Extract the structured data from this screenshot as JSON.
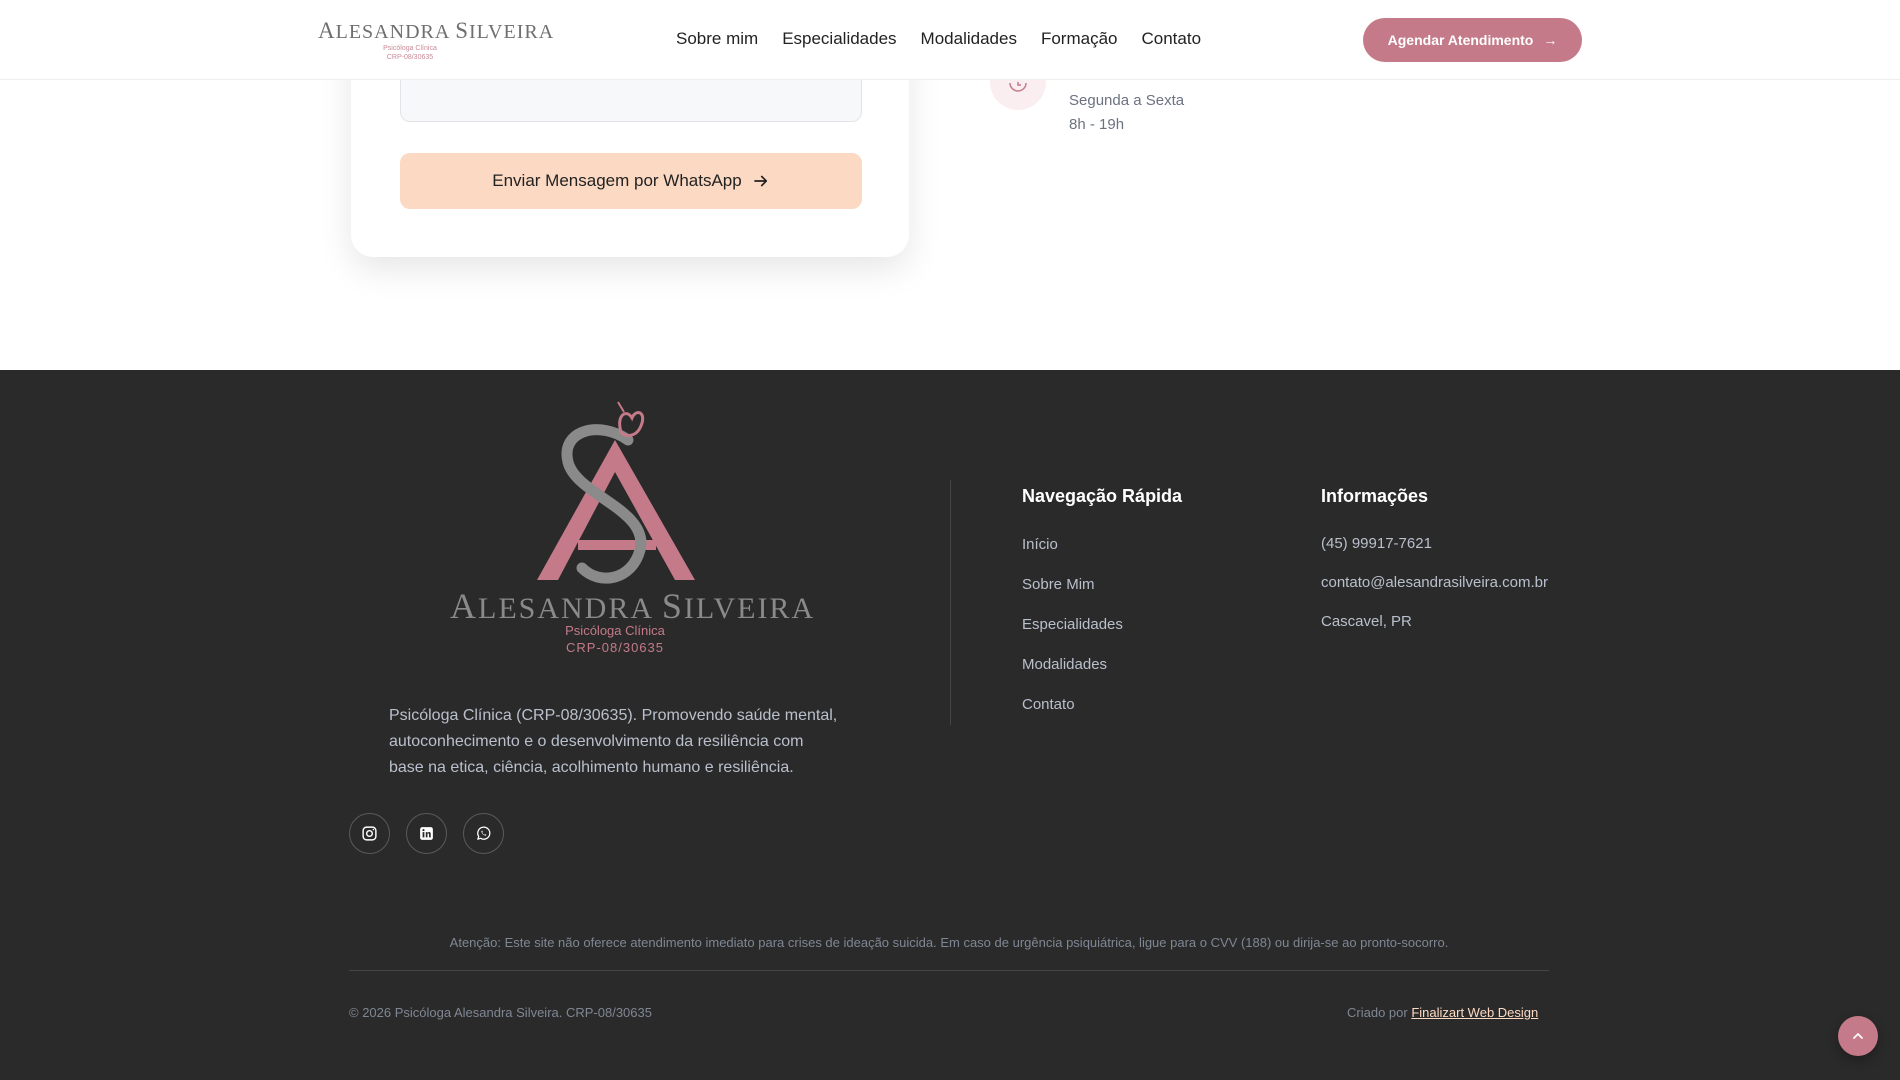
{
  "header": {
    "logo": {
      "name_first_cap": "A",
      "name_first_rest": "LESANDRA",
      "name_last_cap": "S",
      "name_last_rest": "ILVEIRA",
      "subtitle1": "Psicóloga Clínica",
      "subtitle2": "CRP-08/30635"
    },
    "nav": [
      "Sobre mim",
      "Especialidades",
      "Modalidades",
      "Formação",
      "Contato"
    ],
    "cta_label": "Agendar Atendimento"
  },
  "form": {
    "send_button_label": "Enviar Mensagem por WhatsApp"
  },
  "hours": {
    "days": "Segunda a Sexta",
    "time": "8h - 19h"
  },
  "footer": {
    "logo": {
      "name_first_cap": "A",
      "name_first_rest": "LESANDRA",
      "name_last_cap": "S",
      "name_last_rest": "ILVEIRA",
      "subtitle1": "Psicóloga Clínica",
      "subtitle2": "CRP-08/30635"
    },
    "about": "Psicóloga Clínica (CRP-08/30635). Promovendo saúde mental, autoconhecimento e o desenvolvimento da resiliência com base na etica, ciência, acolhimento humano e resiliência.",
    "quick_nav": {
      "title": "Navegação Rápida",
      "links": [
        "Início",
        "Sobre Mim",
        "Especialidades",
        "Modalidades",
        "Contato"
      ]
    },
    "info": {
      "title": "Informações",
      "phone": "(45) 99917-7621",
      "email": "contato@alesandrasilveira.com.br",
      "city": "Cascavel, PR"
    },
    "warning": "Atenção: Este site não oferece atendimento imediato para crises de ideação suicida. Em caso de urgência psiquiátrica, ligue para o CVV (188) ou dirija-se ao pronto-socorro.",
    "copyright": "© 2026 Psicóloga Alesandra Silveira. CRP-08/30635",
    "credit_prefix": "Criado por",
    "credit_link": "Finalizart Web Design"
  },
  "colors": {
    "accent": "#c47a89",
    "peach": "#fcd9c2",
    "footer_bg": "#2a2a2a"
  },
  "icons": {
    "socials": [
      "instagram-icon",
      "linkedin-icon",
      "whatsapp-icon"
    ],
    "back_to_top": "chevron-up-icon"
  }
}
